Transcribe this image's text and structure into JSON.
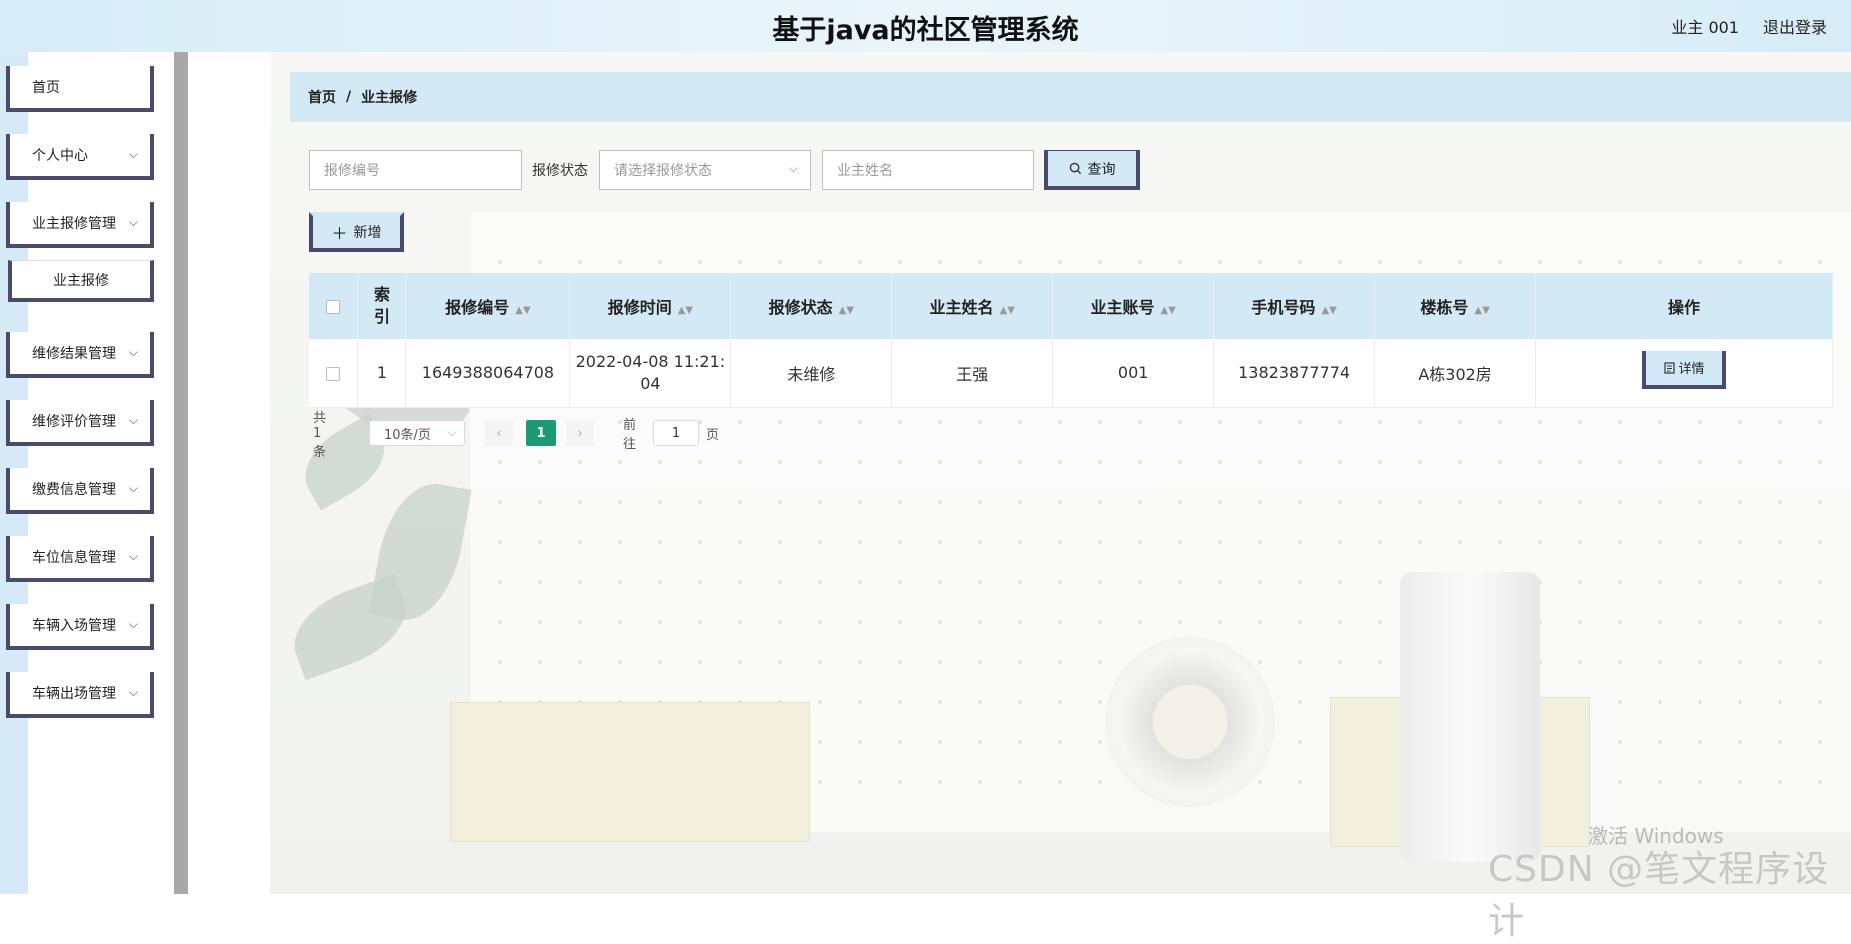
{
  "header": {
    "title": "基于java的社区管理系统",
    "user": "业主 001",
    "logout": "退出登录"
  },
  "sidebar": {
    "items": [
      {
        "label": "首页",
        "has_chevron": false
      },
      {
        "label": "个人中心",
        "has_chevron": true
      },
      {
        "label": "业主报修管理",
        "has_chevron": true
      },
      {
        "label": "维修结果管理",
        "has_chevron": true
      },
      {
        "label": "维修评价管理",
        "has_chevron": true
      },
      {
        "label": "缴费信息管理",
        "has_chevron": true
      },
      {
        "label": "车位信息管理",
        "has_chevron": true
      },
      {
        "label": "车辆入场管理",
        "has_chevron": true
      },
      {
        "label": "车辆出场管理",
        "has_chevron": true
      }
    ],
    "submenu": {
      "label": "业主报修"
    }
  },
  "breadcrumb": {
    "home": "首页",
    "separator": "/",
    "current": "业主报修"
  },
  "search": {
    "repair_no_placeholder": "报修编号",
    "status_label": "报修状态",
    "status_placeholder": "请选择报修状态",
    "owner_name_placeholder": "业主姓名",
    "query_label": "查询"
  },
  "toolbar": {
    "add_label": "新增"
  },
  "table": {
    "headers": [
      "索引",
      "报修编号",
      "报修时间",
      "报修状态",
      "业主姓名",
      "业主账号",
      "手机号码",
      "楼栋号",
      "操作"
    ],
    "rows": [
      {
        "index": "1",
        "repair_no": "1649388064708",
        "repair_time_line1": "2022-04-08 11:21:",
        "repair_time_line2": "04",
        "status": "未维修",
        "owner_name": "王强",
        "owner_account": "001",
        "phone": "13823877774",
        "building": "A栋302房",
        "action": "详情"
      }
    ]
  },
  "pagination": {
    "total": "共 1 条",
    "page_size": "10条/页",
    "current_page": "1",
    "goto_label": "前往",
    "goto_value": "1",
    "page_suffix": "页"
  },
  "watermark": {
    "activate": "激活 Windows",
    "csdn": "CSDN @笔文程序设计"
  }
}
